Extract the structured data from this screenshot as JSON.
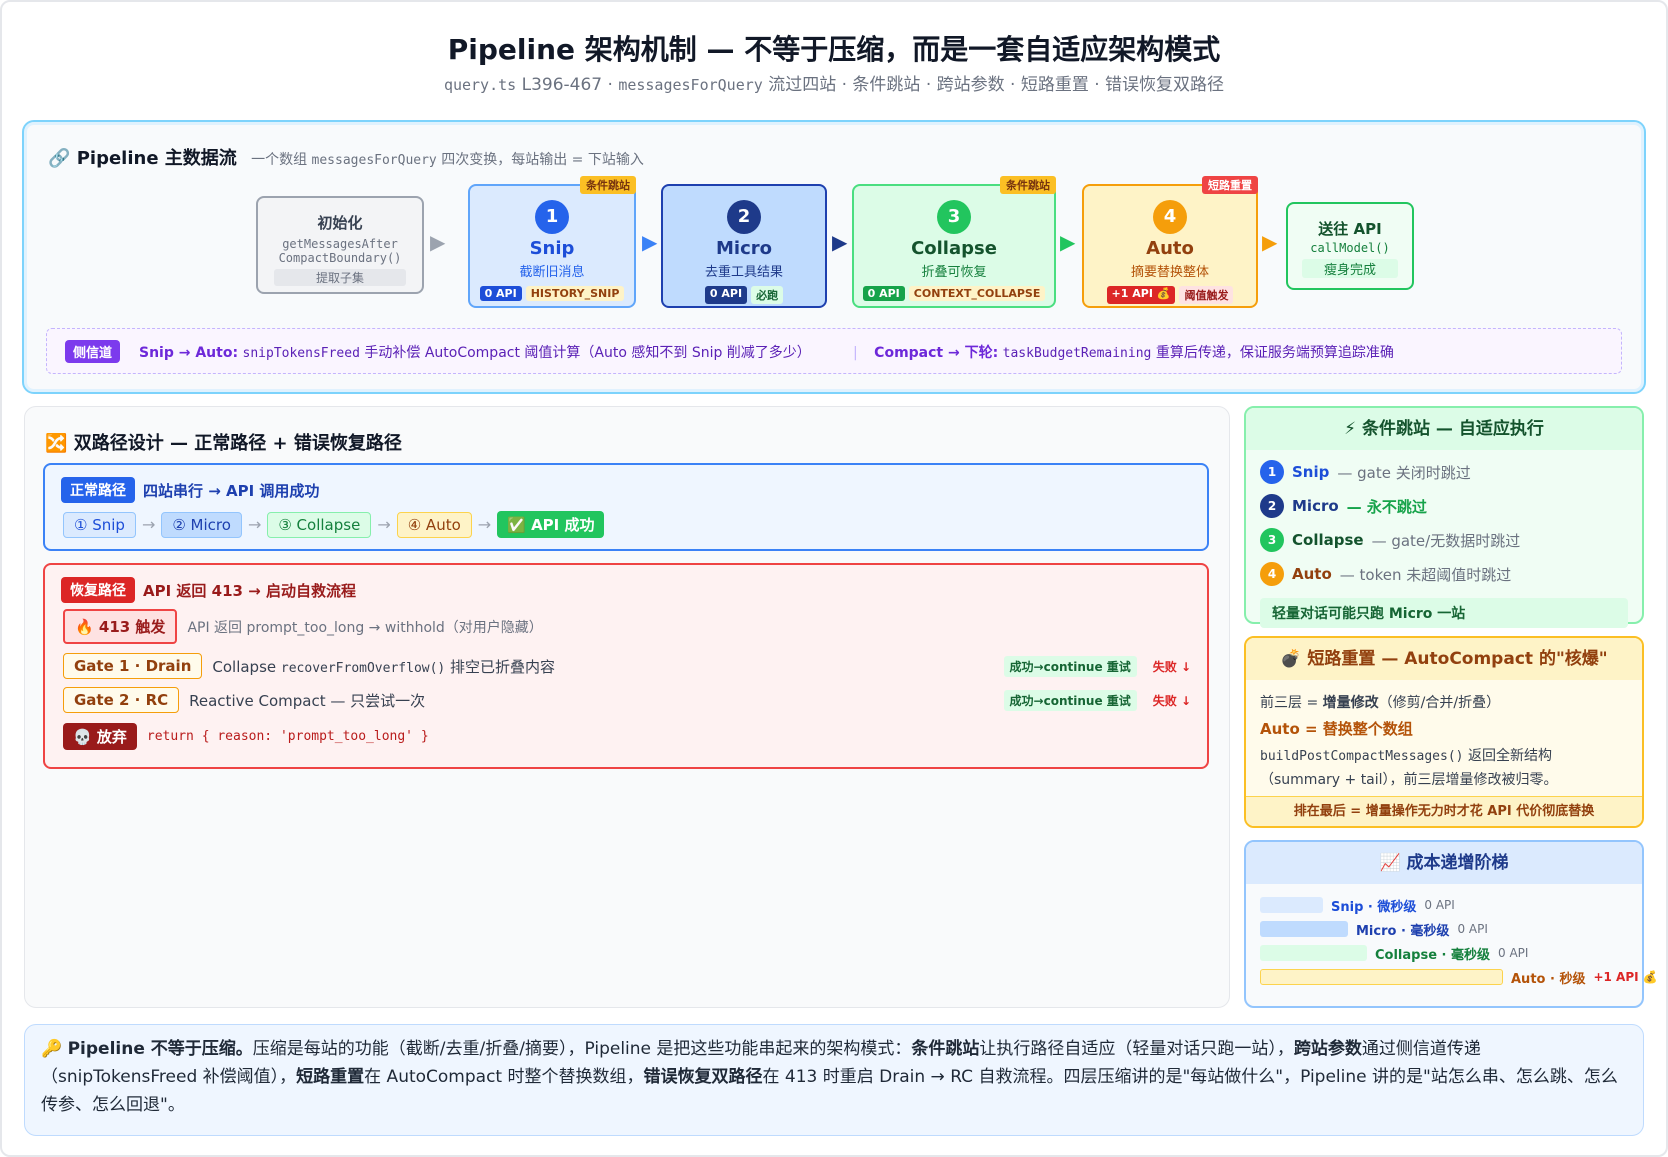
{
  "header": {
    "title": "Pipeline 架构机制 — 不等于压缩，而是一套自适应架构模式",
    "sub_code1": "query.ts",
    "sub_text1": " L396-467 · ",
    "sub_code2": "messagesForQuery",
    "sub_text2": " 流过四站 · 条件跳站 · 跨站参数 · 短路重置 · 错误恢复双路径"
  },
  "pipeline": {
    "icon": "🔗",
    "title": "Pipeline 主数据流",
    "sub_a": "一个数组 ",
    "sub_code": "messagesForQuery",
    "sub_b": " 四次变换，每站输出 = 下站输入",
    "init": {
      "name": "初始化",
      "code1": "getMessagesAfter",
      "code2": "CompactBoundary()",
      "desc": "提取子集"
    },
    "stations": [
      {
        "num": "1",
        "name": "Snip",
        "desc": "截断旧消息",
        "api": "0 API",
        "flag": "HISTORY_SNIP",
        "corner": "条件跳站"
      },
      {
        "num": "2",
        "name": "Micro",
        "desc": "去重工具结果",
        "api": "0 API",
        "flag": "必跑",
        "corner": ""
      },
      {
        "num": "3",
        "name": "Collapse",
        "desc": "折叠可恢复",
        "api": "0 API",
        "flag": "CONTEXT_COLLAPSE",
        "corner": "条件跳站"
      },
      {
        "num": "4",
        "name": "Auto",
        "desc": "摘要替换整体",
        "api": "+1 API 💰",
        "flag": "阈值触发",
        "corner": "短路重置"
      }
    ],
    "send": {
      "name": "送往 API",
      "code": "callModel()",
      "desc": "瘦身完成"
    },
    "arrow": "▶",
    "sidechannel": {
      "tag": "侧信道",
      "a_bold": "Snip → Auto:",
      "a_code": "snipTokensFreed",
      "a_text": " 手动补偿 AutoCompact 阈值计算（Auto 感知不到 Snip 削减了多少）",
      "sep": "|",
      "b_bold": "Compact → 下轮:",
      "b_code": "taskBudgetRemaining",
      "b_text": " 重算后传递，保证服务端预算追踪准确"
    }
  },
  "dual": {
    "icon": "🔀",
    "title": "双路径设计 — 正常路径 + 错误恢复路径",
    "normal": {
      "tag": "正常路径",
      "desc": "四站串行 → API 调用成功",
      "chips": [
        "① Snip",
        "② Micro",
        "③ Collapse",
        "④ Auto",
        "✅ API 成功"
      ],
      "arrow": "→"
    },
    "recovery": {
      "tag": "恢复路径",
      "desc": "API 返回 413 → 启动自救流程",
      "trigger": "🔥 413 触发",
      "trigger_desc": "API 返回 prompt_too_long → withhold（对用户隐藏）",
      "gate1": "Gate 1 · Drain",
      "gate1_a": "Collapse ",
      "gate1_code": "recoverFromOverflow()",
      "gate1_b": " 排空已折叠内容",
      "gate2": "Gate 2 · RC",
      "gate2_desc": "Reactive Compact — 只尝试一次",
      "ok": "成功→continue 重试",
      "fail": "失败 ↓",
      "abandon": "💀 放弃",
      "abandon_code": "return { reason: 'prompt_too_long' }"
    }
  },
  "conditional": {
    "title": "⚡ 条件跳站 — 自适应执行",
    "items": [
      {
        "num": "1",
        "name": "Snip",
        "desc": "— gate 关闭时跳过"
      },
      {
        "num": "2",
        "name": "Micro",
        "desc": "— 永不跳过"
      },
      {
        "num": "3",
        "name": "Collapse",
        "desc": "— gate/无数据时跳过"
      },
      {
        "num": "4",
        "name": "Auto",
        "desc": "— token 未超阈值时跳过"
      }
    ],
    "note": "轻量对话可能只跑 Micro 一站"
  },
  "shortcircuit": {
    "title": "💣 短路重置 — AutoCompact 的\"核爆\"",
    "l1_a": "前三层 = ",
    "l1_b": "增量修改",
    "l1_c": "（修剪/合并/折叠）",
    "l2": "Auto = 替换整个数组",
    "l3_code": "buildPostCompactMessages()",
    "l3_text": " 返回全新结构",
    "l4": "（summary + tail），前三层增量修改被归零。",
    "footer": "排在最后 = 增量操作无力时才花 API 代价彻底替换"
  },
  "cost": {
    "title": "📈 成本递增阶梯",
    "rows": [
      {
        "label": "Snip · 微秒级",
        "api": "0 API",
        "level": 0.17,
        "color": "#dbeafe"
      },
      {
        "label": "Micro · 毫秒级",
        "api": "0 API",
        "level": 0.24,
        "color": "#bfdbfe"
      },
      {
        "label": "Collapse · 毫秒级",
        "api": "0 API",
        "level": 0.29,
        "color": "#dcfce7"
      },
      {
        "label": "Auto · 秒级",
        "api": "+1 API 💰",
        "level": 0.66,
        "color": "#fef3c7"
      }
    ]
  },
  "summary": {
    "icon": "🔑",
    "b1": "Pipeline 不等于压缩。",
    "t1": "压缩是每站的功能（截断/去重/折叠/摘要），Pipeline 是把这些功能串起来的架构模式：",
    "b2": "条件跳站",
    "t2": "让执行路径自适应（轻量对话只跑一站），",
    "b3": "跨站参数",
    "t3": "通过侧信道传递（snipTokensFreed 补偿阈值），",
    "b4": "短路重置",
    "t4": "在 AutoCompact 时整个替换数组，",
    "b5": "错误恢复双路径",
    "t5": "在 413 时重启 Drain → RC 自救流程。四层压缩讲的是\"每站做什么\"，Pipeline 讲的是\"站怎么串、怎么跳、怎么传参、怎么回退\"。"
  }
}
